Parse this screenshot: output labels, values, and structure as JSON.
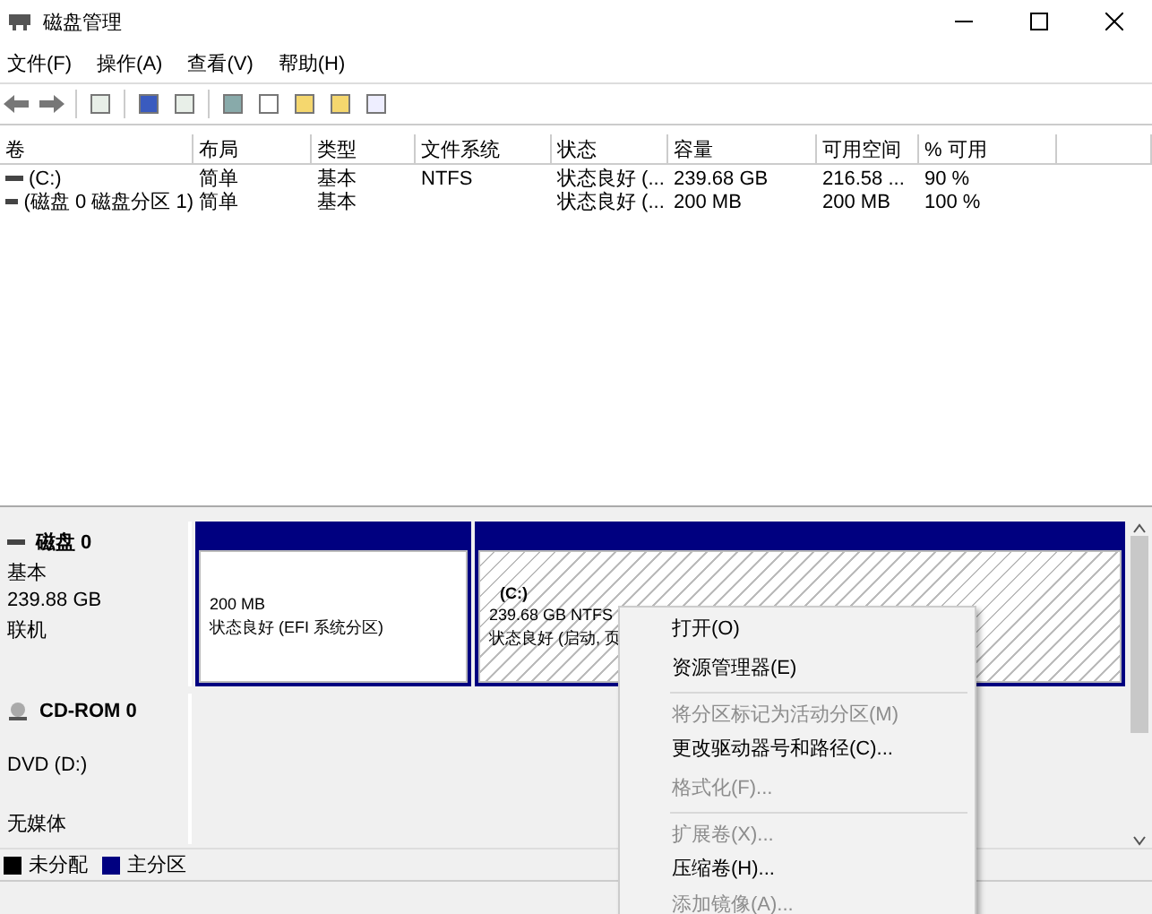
{
  "window": {
    "title": "磁盘管理"
  },
  "menu": [
    "文件(F)",
    "操作(A)",
    "查看(V)",
    "帮助(H)"
  ],
  "table": {
    "columns": [
      "卷",
      "布局",
      "类型",
      "文件系统",
      "状态",
      "容量",
      "可用空间",
      "% 可用"
    ],
    "rows": [
      [
        "(C:)",
        "简单",
        "基本",
        "NTFS",
        "状态良好 (...",
        "239.68 GB",
        "216.58 ...",
        "90 %"
      ],
      [
        "(磁盘 0 磁盘分区 1)",
        "简单",
        "基本",
        "",
        "状态良好 (...",
        "200 MB",
        "200 MB",
        "100 %"
      ]
    ]
  },
  "disks": [
    {
      "kind": "disk",
      "name": "磁盘 0",
      "lines": [
        "基本",
        "239.88 GB",
        "联机"
      ],
      "partitions": [
        {
          "size": "200 MB",
          "status": "状态良好 (EFI 系统分区)",
          "selected": false
        },
        {
          "label": "(C:)",
          "size": "239.68 GB NTFS",
          "status": "状态良好 (启动, 页",
          "selected": true
        }
      ]
    },
    {
      "kind": "cdrom",
      "name": "CD-ROM 0",
      "lines": [
        "DVD (D:)",
        "无媒体"
      ]
    }
  ],
  "legend": [
    {
      "label": "未分配",
      "color": "#000000"
    },
    {
      "label": "主分区",
      "color": "#000080"
    }
  ],
  "context_menu": [
    {
      "label": "打开(O)",
      "disabled": false,
      "separator_after": false
    },
    {
      "label": "资源管理器(E)",
      "disabled": false,
      "separator_after": true
    },
    {
      "label": "将分区标记为活动分区(M)",
      "disabled": true,
      "separator_after": false
    },
    {
      "label": "更改驱动器号和路径(C)...",
      "disabled": false,
      "separator_after": false
    },
    {
      "label": "格式化(F)...",
      "disabled": true,
      "separator_after": true
    },
    {
      "label": "扩展卷(X)...",
      "disabled": true,
      "separator_after": false
    },
    {
      "label": "压缩卷(H)...",
      "disabled": false,
      "separator_after": false
    },
    {
      "label": "添加镜像(A)...",
      "disabled": true,
      "separator_after": false
    }
  ]
}
